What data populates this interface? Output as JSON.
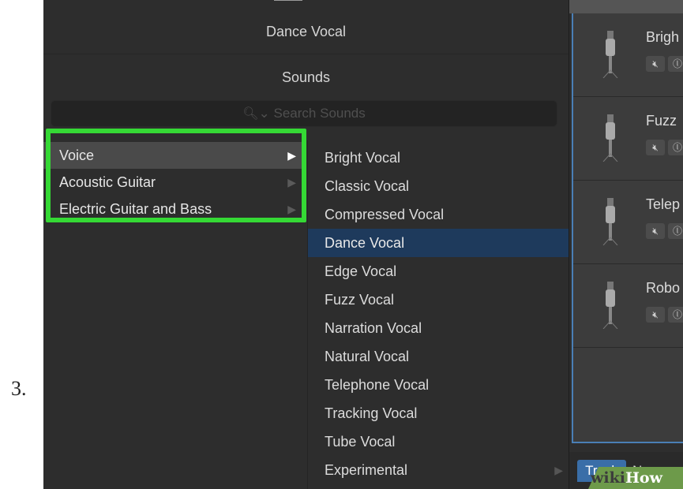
{
  "step_number": "3.",
  "library": {
    "patch_name": "Dance Vocal",
    "sounds_header": "Sounds",
    "search_placeholder": "Search Sounds",
    "categories": [
      {
        "label": "Voice",
        "selected": true
      },
      {
        "label": "Acoustic Guitar",
        "selected": false
      },
      {
        "label": "Electric Guitar and Bass",
        "selected": false
      }
    ],
    "sounds": [
      {
        "label": "Bright Vocal"
      },
      {
        "label": "Classic Vocal"
      },
      {
        "label": "Compressed Vocal"
      },
      {
        "label": "Dance Vocal",
        "selected": true
      },
      {
        "label": "Edge Vocal"
      },
      {
        "label": "Fuzz Vocal"
      },
      {
        "label": "Narration Vocal"
      },
      {
        "label": "Natural Vocal"
      },
      {
        "label": "Telephone Vocal"
      },
      {
        "label": "Tracking Vocal"
      },
      {
        "label": "Tube Vocal"
      },
      {
        "label": "Experimental",
        "has_submenu": true
      }
    ]
  },
  "tracks": {
    "rows": [
      {
        "name": "Brigh"
      },
      {
        "name": "Fuzz"
      },
      {
        "name": "Telep"
      },
      {
        "name": "Robo"
      }
    ],
    "tabs": {
      "track": "Track",
      "next": "N"
    }
  },
  "watermark": {
    "wiki": "wiki",
    "how": "How"
  },
  "colors": {
    "highlight_box": "#35d935",
    "selected_sound": "#1e3a5c",
    "selected_category": "#4a4a4a",
    "accent_blue": "#3a6ea8"
  }
}
